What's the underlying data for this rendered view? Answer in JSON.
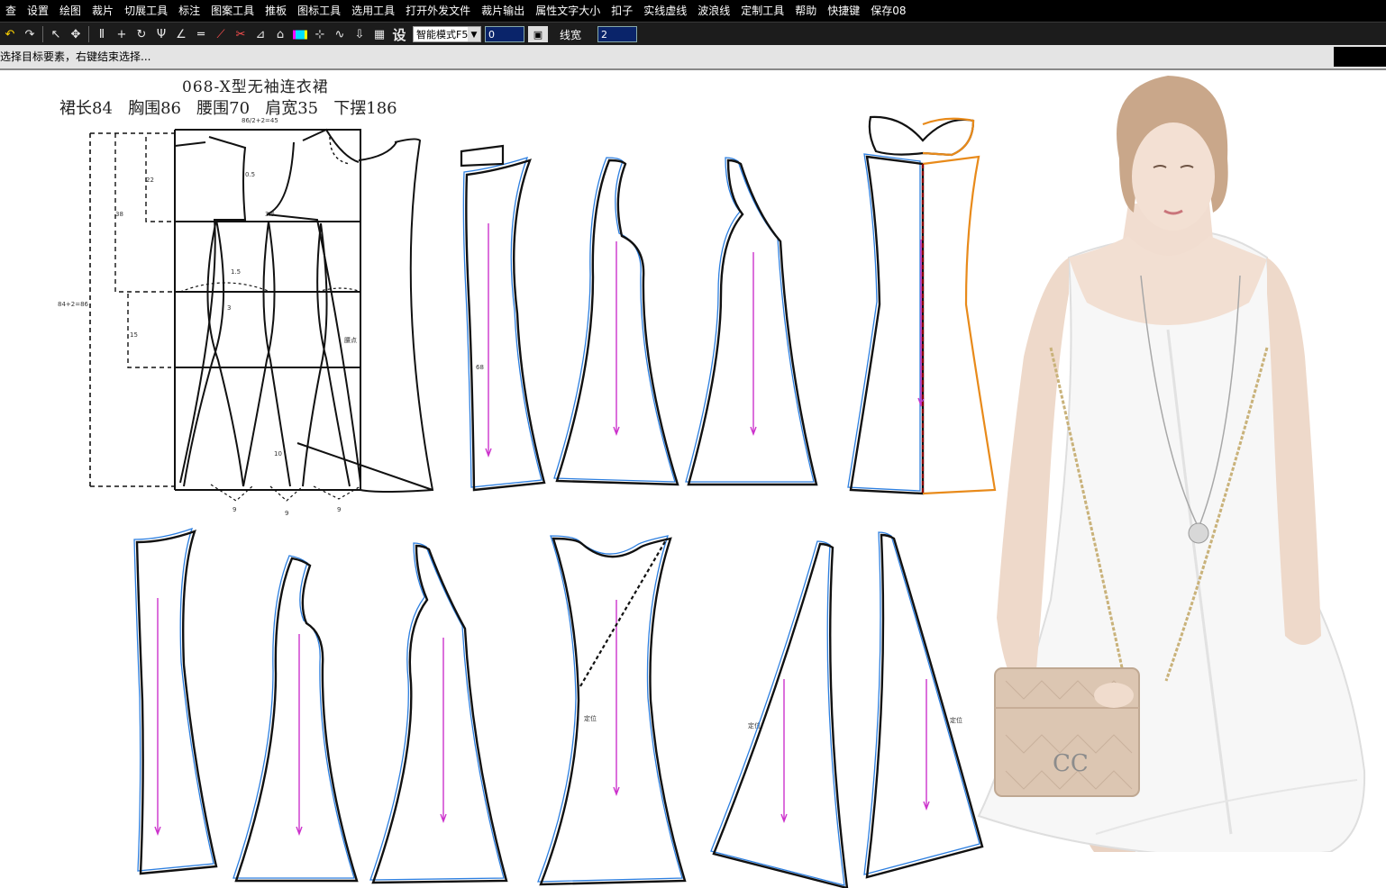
{
  "menu": [
    "查",
    "设置",
    "绘图",
    "裁片",
    "切展工具",
    "标注",
    "图案工具",
    "推板",
    "图标工具",
    "选用工具",
    "打开外发文件",
    "裁片输出",
    "属性文字大小",
    "扣子",
    "实线虚线",
    "波浪线",
    "定制工具",
    "帮助",
    "快捷键",
    "保存08"
  ],
  "toolbar": {
    "icons": [
      "undo-icon",
      "redo-icon",
      "select-arrow-icon",
      "move-icon",
      "text-icon",
      "crosshair-icon",
      "rotate-icon",
      "fork-icon",
      "angle-icon",
      "parallel-icon",
      "mirror-icon",
      "cut-icon",
      "measure-icon",
      "hanger-icon",
      "color-icon",
      "align-icon",
      "curve-icon",
      "arrow-down-icon",
      "image-icon"
    ],
    "settings_glyph": "设",
    "mode": "智能模式F5",
    "field_value": "0",
    "line_width_label": "线宽",
    "line_width_value": "2"
  },
  "status": {
    "hint": "选择目标要素，右键结束选择..."
  },
  "pattern": {
    "title": "068-X型无袖连衣裙",
    "specs": "裙长84   胸围86   腰围70   肩宽35   下摆186",
    "annotations": [
      "86/2+2=45",
      "22",
      "38",
      "84+2=86",
      "15",
      "0.5",
      "3.5",
      "1.5",
      "3",
      "10",
      "9",
      "9",
      "9",
      "腰点",
      "68",
      "定位",
      "定位",
      "定位"
    ]
  },
  "colors": {
    "outline": "#111111",
    "seam": "#2d7fe0",
    "grain": "#cc33cc",
    "mirror": "#e88a1a",
    "fold": "#8b0000"
  },
  "photo": {
    "logo": "CC"
  }
}
